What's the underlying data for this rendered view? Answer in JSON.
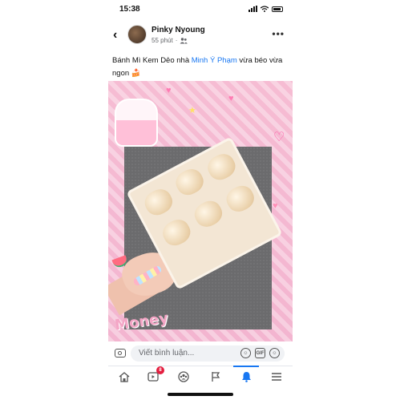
{
  "status_bar": {
    "time": "15:38",
    "location_arrow": "location-arrow-icon"
  },
  "post": {
    "author": "Pinky Nyoung",
    "time_ago": "55 phút",
    "audience_icon": "friends-icon",
    "caption_prefix": "Bánh Mì Kem Dẻo nhà ",
    "mention": "Minh Ý Phạm",
    "caption_suffix": " vừa béo vừa ngon",
    "caption_emoji": "🍰",
    "photo_text": "Money"
  },
  "comment": {
    "placeholder": "Viết bình luận..."
  },
  "tabs": [
    {
      "name": "home",
      "icon": "home-icon"
    },
    {
      "name": "watch",
      "icon": "video-icon",
      "badge": "8"
    },
    {
      "name": "groups",
      "icon": "groups-icon"
    },
    {
      "name": "pages",
      "icon": "flag-icon"
    },
    {
      "name": "notifications",
      "icon": "bell-icon",
      "active": true
    },
    {
      "name": "menu",
      "icon": "menu-icon"
    }
  ],
  "colors": {
    "accent": "#1877f2",
    "badge": "#e41e3f",
    "photo_bg": "#f6bcd3"
  }
}
